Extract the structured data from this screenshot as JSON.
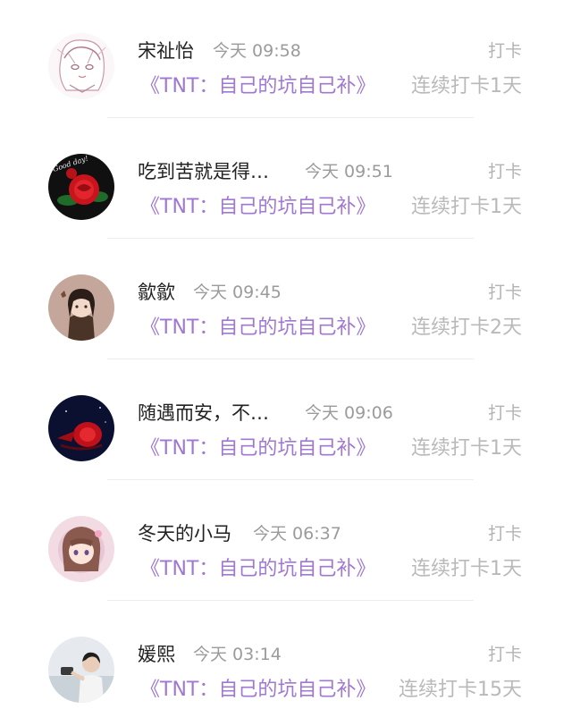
{
  "feed": {
    "items": [
      {
        "name": "宋祉怡",
        "time": "今天 09:58",
        "action": "打卡",
        "group": "《TNT：自己的坑自己补》",
        "streak": "连续打卡1天",
        "avatar_icon": "sketch-girl-avatar-icon"
      },
      {
        "name": "吃到苦就是得…",
        "time": "今天 09:51",
        "action": "打卡",
        "group": "《TNT：自己的坑自己补》",
        "streak": "连续打卡1天",
        "avatar_icon": "red-rose-avatar-icon",
        "avatar_text": "Good day!"
      },
      {
        "name": "歙歙",
        "time": "今天 09:45",
        "action": "打卡",
        "group": "《TNT：自己的坑自己补》",
        "streak": "连续打卡2天",
        "avatar_icon": "anime-girl-avatar-icon"
      },
      {
        "name": "随遇而安，不…",
        "time": "今天 09:06",
        "action": "打卡",
        "group": "《TNT：自己的坑自己补》",
        "streak": "连续打卡1天",
        "avatar_icon": "red-rose-night-avatar-icon"
      },
      {
        "name": "冬天的小马",
        "time": "今天 06:37",
        "action": "打卡",
        "group": "《TNT：自己的坑自己补》",
        "streak": "连续打卡1天",
        "avatar_icon": "pink-anime-avatar-icon"
      },
      {
        "name": "媛熙",
        "time": "今天 03:14",
        "action": "打卡",
        "group": "《TNT：自己的坑自己补》",
        "streak": "连续打卡15天",
        "avatar_icon": "photo-person-avatar-icon"
      }
    ]
  },
  "colors": {
    "group_link": "#a078d2",
    "name_text": "#222222",
    "meta_text": "#9b9b9b",
    "streak_text": "#b9b9b9"
  }
}
